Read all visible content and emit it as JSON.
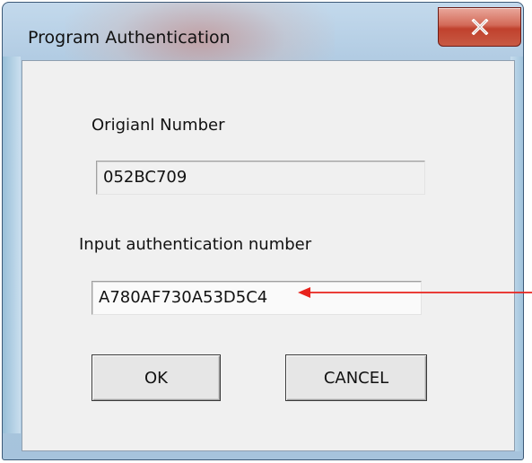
{
  "window": {
    "title": "Program Authentication",
    "close_icon": "close-x-icon"
  },
  "form": {
    "original_label": "Origianl Number",
    "original_value": "052BC709",
    "auth_label": "Input authentication number",
    "auth_value": "A780AF730A53D5C4"
  },
  "buttons": {
    "ok_label": "OK",
    "cancel_label": "CANCEL"
  },
  "colors": {
    "annotation_arrow": "#e8231d",
    "close_button": "#c8412d"
  }
}
